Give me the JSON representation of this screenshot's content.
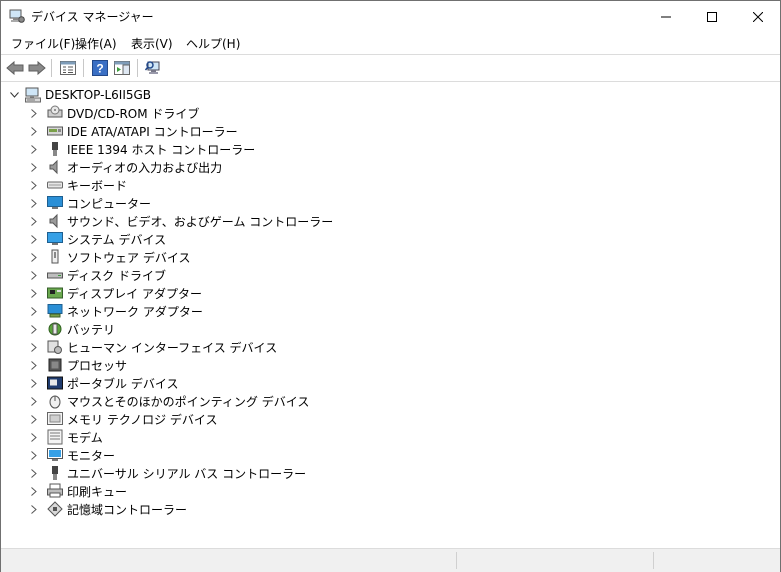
{
  "window": {
    "title": "デバイス マネージャー"
  },
  "menu": {
    "items": [
      {
        "label": "ファイル(F)"
      },
      {
        "label": "操作(A)"
      },
      {
        "label": "表示(V)"
      },
      {
        "label": "ヘルプ(H)"
      }
    ]
  },
  "toolbar": {
    "buttons": [
      {
        "icon": "back-arrow-icon"
      },
      {
        "icon": "forward-arrow-icon"
      },
      {
        "icon": "properties-pane-icon"
      },
      {
        "icon": "help-icon"
      },
      {
        "icon": "action-pane-icon"
      },
      {
        "icon": "scan-hardware-icon"
      }
    ]
  },
  "tree": {
    "root": {
      "label": "DESKTOP-L6II5GB",
      "expanded": true,
      "icon": "computer-icon"
    },
    "categories": [
      {
        "label": "DVD/CD-ROM ドライブ",
        "icon": "dvd-drive-icon"
      },
      {
        "label": "IDE ATA/ATAPI コントローラー",
        "icon": "ide-controller-icon"
      },
      {
        "label": "IEEE 1394 ホスト コントローラー",
        "icon": "ieee1394-icon"
      },
      {
        "label": "オーディオの入力および出力",
        "icon": "audio-io-icon"
      },
      {
        "label": "キーボード",
        "icon": "keyboard-icon"
      },
      {
        "label": "コンピューター",
        "icon": "computer-monitor-icon"
      },
      {
        "label": "サウンド、ビデオ、およびゲーム コントローラー",
        "icon": "sound-icon"
      },
      {
        "label": "システム デバイス",
        "icon": "system-device-icon"
      },
      {
        "label": "ソフトウェア デバイス",
        "icon": "software-device-icon"
      },
      {
        "label": "ディスク ドライブ",
        "icon": "disk-drive-icon"
      },
      {
        "label": "ディスプレイ アダプター",
        "icon": "display-adapter-icon"
      },
      {
        "label": "ネットワーク アダプター",
        "icon": "network-adapter-icon"
      },
      {
        "label": "バッテリ",
        "icon": "battery-icon"
      },
      {
        "label": "ヒューマン インターフェイス デバイス",
        "icon": "hid-icon"
      },
      {
        "label": "プロセッサ",
        "icon": "processor-icon"
      },
      {
        "label": "ポータブル デバイス",
        "icon": "portable-device-icon"
      },
      {
        "label": "マウスとそのほかのポインティング デバイス",
        "icon": "mouse-icon"
      },
      {
        "label": "メモリ テクノロジ デバイス",
        "icon": "memory-tech-icon"
      },
      {
        "label": "モデム",
        "icon": "modem-icon"
      },
      {
        "label": "モニター",
        "icon": "monitor-icon"
      },
      {
        "label": "ユニバーサル シリアル バス コントローラー",
        "icon": "usb-icon"
      },
      {
        "label": "印刷キュー",
        "icon": "print-queue-icon"
      },
      {
        "label": "記憶域コントローラー",
        "icon": "storage-controller-icon"
      }
    ]
  },
  "colors": {
    "accent": "#0078d7",
    "icon_gray": "#6d6d6d",
    "monitor_blue": "#2a8fd6"
  }
}
